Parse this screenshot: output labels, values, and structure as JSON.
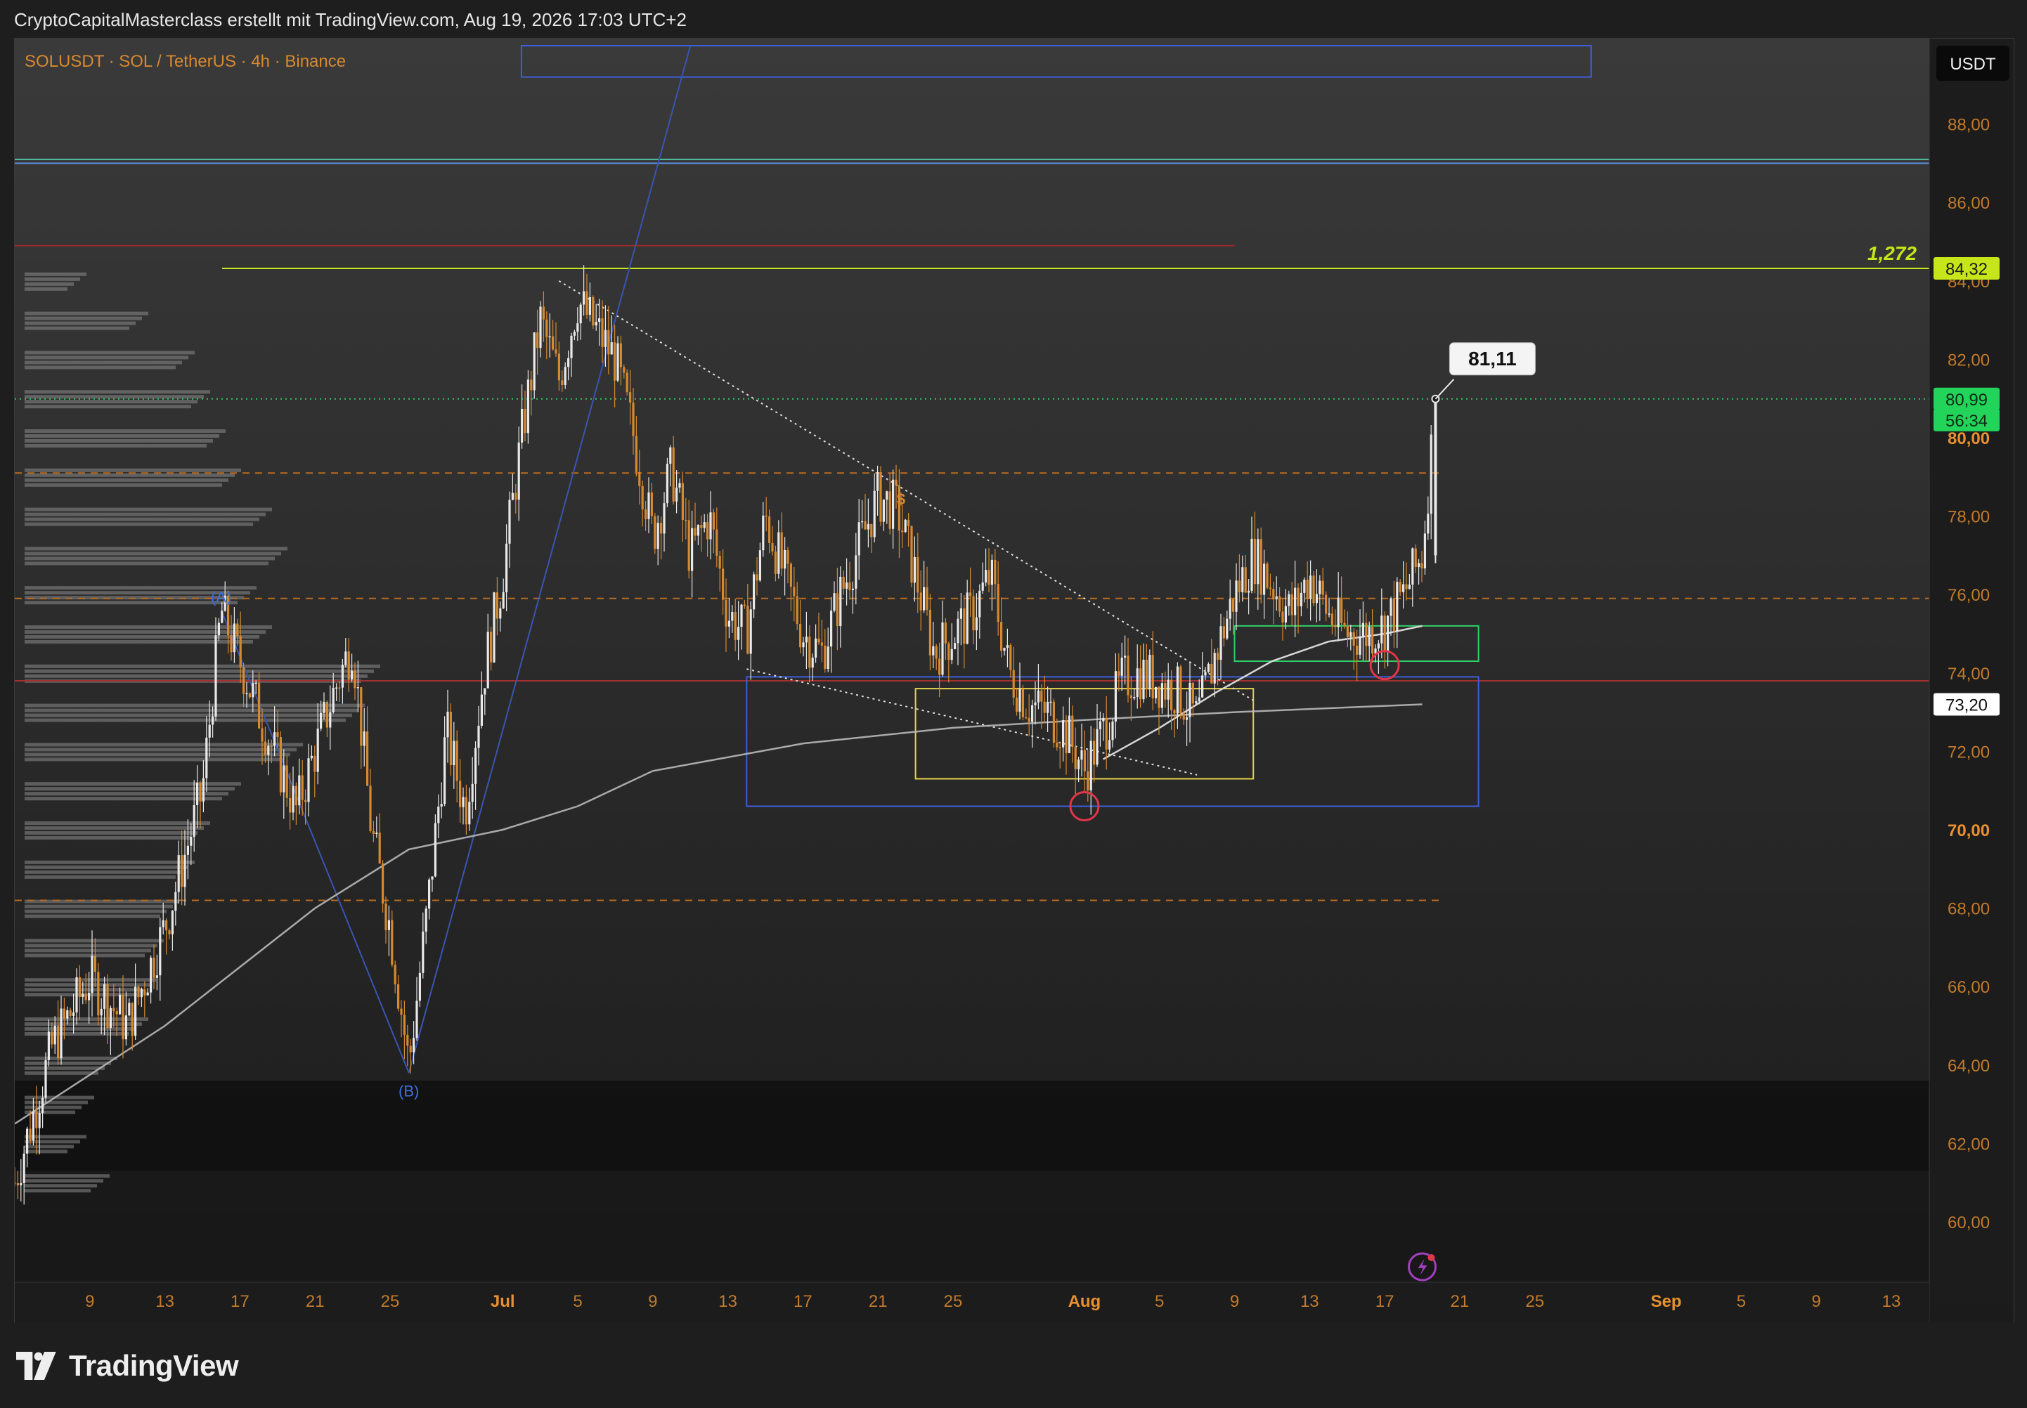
{
  "header": {
    "attribution": "CryptoCapitalMasterclass erstellt mit TradingView.com, Aug 19, 2026 17:03 UTC+2"
  },
  "footer": {
    "brand": "TradingView"
  },
  "chart_data": {
    "type": "candlestick",
    "title": "SOLUSDT · SOL / TetherUS · 4h · Binance",
    "currency_button": "USDT",
    "y_axis": {
      "ticks": [
        "88,00",
        "86,00",
        "84,00",
        "82,00",
        "80,00",
        "78,00",
        "76,00",
        "74,00",
        "72,00",
        "70,00",
        "68,00",
        "66,00",
        "64,00",
        "62,00",
        "60,00"
      ],
      "tick_values": [
        88,
        86,
        84,
        82,
        80,
        78,
        76,
        74,
        72,
        70,
        68,
        66,
        64,
        62,
        60
      ],
      "range": [
        58.8,
        89.5
      ]
    },
    "x_axis": {
      "labels": [
        "9",
        "13",
        "17",
        "21",
        "25",
        "Jul",
        "5",
        "9",
        "13",
        "17",
        "21",
        "25",
        "Aug",
        "5",
        "9",
        "13",
        "17",
        "21",
        "25",
        "Sep",
        "5",
        "9",
        "13"
      ],
      "dates": [
        "2026-06-09",
        "2026-06-13",
        "2026-06-17",
        "2026-06-21",
        "2026-06-25",
        "2026-07-01",
        "2026-07-05",
        "2026-07-09",
        "2026-07-13",
        "2026-07-17",
        "2026-07-21",
        "2026-07-25",
        "2026-08-01",
        "2026-08-05",
        "2026-08-09",
        "2026-08-13",
        "2026-08-17",
        "2026-08-21",
        "2026-08-25",
        "2026-09-01",
        "2026-09-05",
        "2026-09-09",
        "2026-09-13"
      ]
    },
    "price_path": [
      [
        "2026-06-05",
        61.0
      ],
      [
        "2026-06-07",
        64.5
      ],
      [
        "2026-06-09",
        66.2
      ],
      [
        "2026-06-11",
        65.0
      ],
      [
        "2026-06-13",
        67.5
      ],
      [
        "2026-06-15",
        71.0
      ],
      [
        "2026-06-16",
        75.6
      ],
      [
        "2026-06-18",
        73.0
      ],
      [
        "2026-06-20",
        70.5
      ],
      [
        "2026-06-22",
        73.5
      ],
      [
        "2026-06-23",
        74.8
      ],
      [
        "2026-06-24",
        70.0
      ],
      [
        "2026-06-25",
        67.5
      ],
      [
        "2026-06-26",
        64.0
      ],
      [
        "2026-06-27",
        68.0
      ],
      [
        "2026-06-28",
        72.5
      ],
      [
        "2026-06-29",
        70.5
      ],
      [
        "2026-06-30",
        74.0
      ],
      [
        "2026-07-01",
        76.5
      ],
      [
        "2026-07-02",
        80.0
      ],
      [
        "2026-07-03",
        83.0
      ],
      [
        "2026-07-04",
        81.5
      ],
      [
        "2026-07-05",
        83.5
      ],
      [
        "2026-07-07",
        82.0
      ],
      [
        "2026-07-08",
        80.0
      ],
      [
        "2026-07-09",
        77.5
      ],
      [
        "2026-07-10",
        79.2
      ],
      [
        "2026-07-11",
        77.0
      ],
      [
        "2026-07-12",
        78.0
      ],
      [
        "2026-07-13",
        75.5
      ],
      [
        "2026-07-14",
        75.0
      ],
      [
        "2026-07-15",
        78.0
      ],
      [
        "2026-07-17",
        75.0
      ],
      [
        "2026-07-18",
        74.5
      ],
      [
        "2026-07-19",
        76.0
      ],
      [
        "2026-07-21",
        78.5
      ],
      [
        "2026-07-22",
        78.2
      ],
      [
        "2026-07-23",
        76.5
      ],
      [
        "2026-07-24",
        74.5
      ],
      [
        "2026-07-26",
        75.5
      ],
      [
        "2026-07-27",
        76.5
      ],
      [
        "2026-07-28",
        74.0
      ],
      [
        "2026-07-29",
        73.2
      ],
      [
        "2026-07-30",
        73.0
      ],
      [
        "2026-07-31",
        72.5
      ],
      [
        "2026-08-01",
        71.5
      ],
      [
        "2026-08-02",
        72.5
      ],
      [
        "2026-08-03",
        73.8
      ],
      [
        "2026-08-04",
        74.0
      ],
      [
        "2026-08-06",
        73.5
      ],
      [
        "2026-08-07",
        72.8
      ],
      [
        "2026-08-08",
        74.5
      ],
      [
        "2026-08-09",
        76.0
      ],
      [
        "2026-08-10",
        77.0
      ],
      [
        "2026-08-12",
        75.5
      ],
      [
        "2026-08-13",
        76.5
      ],
      [
        "2026-08-14",
        75.5
      ],
      [
        "2026-08-15",
        75.0
      ],
      [
        "2026-08-16",
        75.0
      ],
      [
        "2026-08-17",
        75.2
      ],
      [
        "2026-08-18",
        76.0
      ],
      [
        "2026-08-19",
        77.0
      ],
      [
        "2026-08-19T17",
        80.99
      ]
    ],
    "moving_average": [
      [
        "2026-06-05",
        62.5
      ],
      [
        "2026-06-13",
        65.0
      ],
      [
        "2026-06-21",
        68.0
      ],
      [
        "2026-06-26",
        69.5
      ],
      [
        "2026-07-01",
        70.0
      ],
      [
        "2026-07-05",
        70.6
      ],
      [
        "2026-07-09",
        71.5
      ],
      [
        "2026-07-17",
        72.2
      ],
      [
        "2026-07-25",
        72.6
      ],
      [
        "2026-08-01",
        72.8
      ],
      [
        "2026-08-09",
        73.0
      ],
      [
        "2026-08-19",
        73.2
      ]
    ],
    "moving_average_short": [
      [
        "2026-08-02",
        71.8
      ],
      [
        "2026-08-05",
        72.6
      ],
      [
        "2026-08-08",
        73.5
      ],
      [
        "2026-08-11",
        74.3
      ],
      [
        "2026-08-14",
        74.8
      ],
      [
        "2026-08-17",
        75.0
      ],
      [
        "2026-08-19",
        75.2
      ]
    ],
    "volume_profile": [
      [
        61,
        55
      ],
      [
        62,
        40
      ],
      [
        63,
        45
      ],
      [
        64,
        60
      ],
      [
        65,
        80
      ],
      [
        66,
        85
      ],
      [
        67,
        90
      ],
      [
        68,
        100
      ],
      [
        69,
        110
      ],
      [
        70,
        120
      ],
      [
        71,
        140
      ],
      [
        72,
        180
      ],
      [
        73,
        220
      ],
      [
        74,
        230
      ],
      [
        75,
        160
      ],
      [
        76,
        150
      ],
      [
        77,
        170
      ],
      [
        78,
        160
      ],
      [
        79,
        140
      ],
      [
        80,
        130
      ],
      [
        81,
        120
      ],
      [
        82,
        110
      ],
      [
        83,
        80
      ],
      [
        84,
        40
      ]
    ],
    "horizontal_levels": [
      {
        "price": 87.1,
        "style": "solid",
        "color": "#4fc3a1"
      },
      {
        "price": 87.0,
        "style": "solid",
        "color": "#5b8dd9"
      },
      {
        "price": 84.9,
        "style": "solid",
        "color": "#9b2b2b",
        "to": "2026-08-09"
      },
      {
        "price": 84.32,
        "style": "solid",
        "color": "#c6e61a",
        "label": "1,272"
      },
      {
        "price": 80.99,
        "style": "dotted",
        "color": "#39c26a"
      },
      {
        "price": 79.1,
        "style": "dashed",
        "color": "#b86b1e",
        "to": "2026-08-20"
      },
      {
        "price": 75.9,
        "style": "dashed",
        "color": "#b86b1e"
      },
      {
        "price": 73.8,
        "style": "solid",
        "color": "#a33030"
      },
      {
        "price": 68.2,
        "style": "dashed",
        "color": "#b86b1e",
        "to": "2026-08-20"
      }
    ],
    "price_labels": [
      {
        "text": "84,32",
        "price": 84.32,
        "bg": "#c6e61a",
        "fg": "#1a1a1a"
      },
      {
        "text": "80,99",
        "price": 80.99,
        "bg": "#22d45a",
        "fg": "#0e2a14"
      },
      {
        "text": "56:34",
        "price": 80.45,
        "bg": "#22d45a",
        "fg": "#0e2a14"
      },
      {
        "text": "73,20",
        "price": 73.2,
        "bg": "#ffffff",
        "fg": "#111111"
      }
    ],
    "current_price": 80.99,
    "countdown": "56:34",
    "callout": {
      "text": "81,11",
      "date": "2026-08-19T17",
      "price": 80.99
    },
    "fib_label": "1,272",
    "wave_labels": [
      {
        "text": "(A)",
        "date": "2026-06-16",
        "price": 75.8
      },
      {
        "text": "(B)",
        "date": "2026-06-26",
        "price": 63.2
      }
    ],
    "zones": [
      {
        "color": "#3d5fd9",
        "from": "2026-07-14",
        "to": "2026-08-22",
        "top": 73.9,
        "bottom": 70.6
      },
      {
        "color": "#e5d24a",
        "from": "2026-07-23",
        "to": "2026-08-10",
        "top": 73.6,
        "bottom": 71.3
      },
      {
        "color": "#2fcf68",
        "from": "2026-08-09",
        "to": "2026-08-22",
        "top": 75.2,
        "bottom": 74.3
      },
      {
        "color": "#3d5fd9",
        "from": "2026-07-02",
        "to": "2026-08-28",
        "top": 90.0,
        "bottom": 89.2
      }
    ],
    "trendlines": [
      {
        "from": [
          "2026-07-04",
          84.0
        ],
        "to": [
          "2026-08-10",
          73.3
        ],
        "style": "dotted"
      },
      {
        "from": [
          "2026-07-14",
          74.1
        ],
        "to": [
          "2026-08-07",
          71.4
        ],
        "style": "dotted"
      },
      {
        "from": [
          "2026-06-26",
          63.8
        ],
        "to": [
          "2026-07-11",
          90.0
        ],
        "style": "solid"
      },
      {
        "from": [
          "2026-06-16",
          75.6
        ],
        "to": [
          "2026-06-26",
          63.8
        ],
        "style": "solid"
      }
    ],
    "circles": [
      {
        "date": "2026-08-01",
        "price": 70.6
      },
      {
        "date": "2026-08-17",
        "price": 74.2
      }
    ]
  }
}
